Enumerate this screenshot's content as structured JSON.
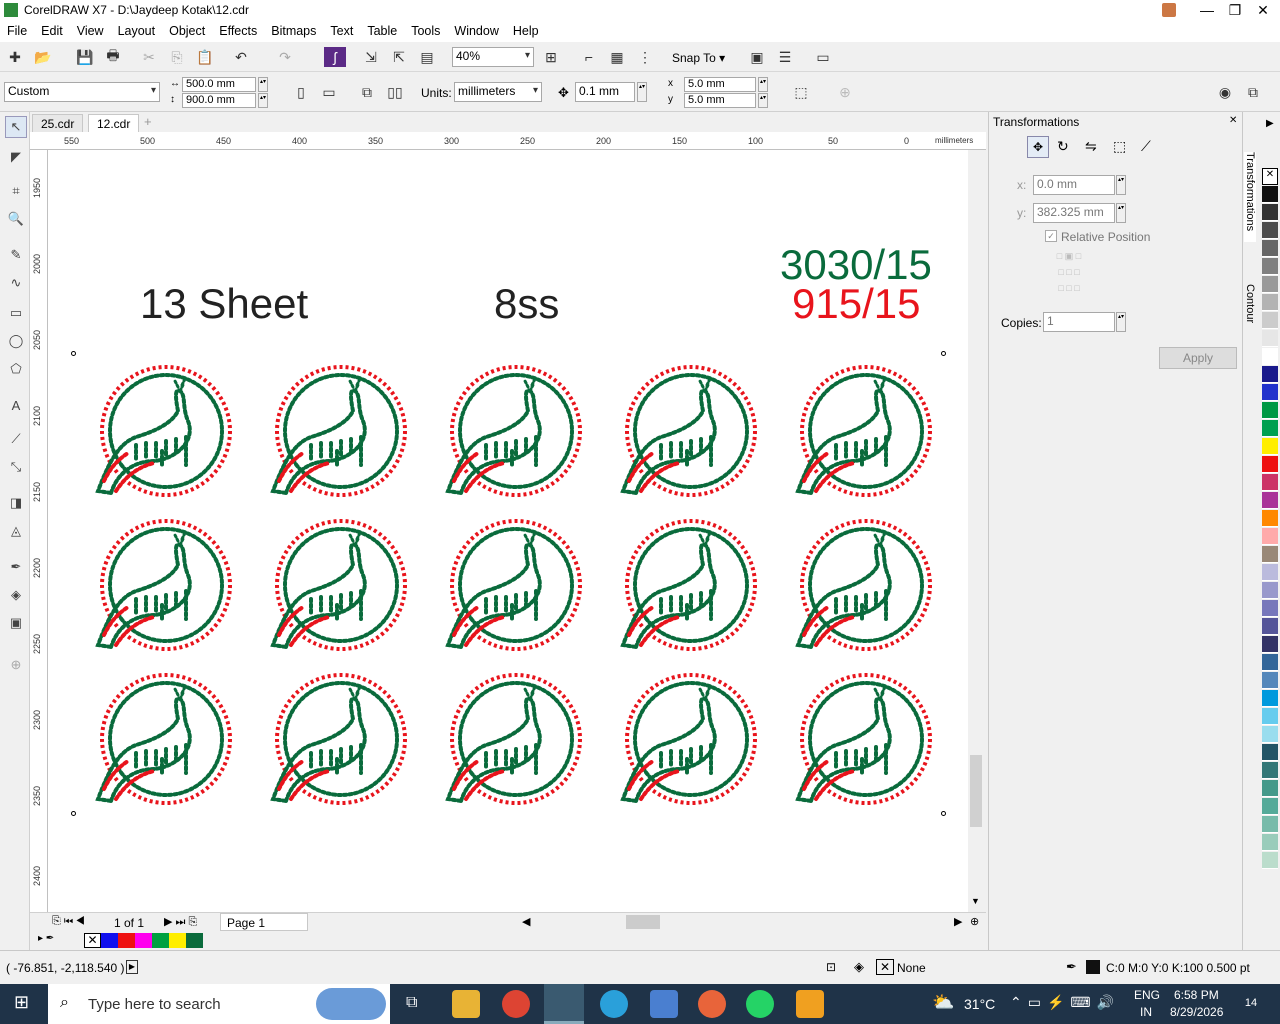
{
  "window": {
    "title": "CorelDRAW X7 - D:\\Jaydeep Kotak\\12.cdr",
    "min": "—",
    "max": "❐",
    "close": "✕"
  },
  "menu": [
    "File",
    "Edit",
    "View",
    "Layout",
    "Object",
    "Effects",
    "Bitmaps",
    "Text",
    "Table",
    "Tools",
    "Window",
    "Help"
  ],
  "toolbar": {
    "zoom": "40%",
    "snap_to": "Snap To"
  },
  "propbar": {
    "preset": "Custom",
    "width": "500.0 mm",
    "height": "900.0 mm",
    "units_label": "Units:",
    "units": "millimeters",
    "nudge": "0.1 mm",
    "dup_x": "5.0 mm",
    "dup_y": "5.0 mm"
  },
  "tabs": [
    {
      "label": "25.cdr"
    },
    {
      "label": "12.cdr"
    }
  ],
  "ruler": {
    "h_ticks": [
      "550",
      "500",
      "450",
      "400",
      "350",
      "300",
      "250",
      "200",
      "150",
      "100",
      "50",
      "0"
    ],
    "h_unit": "millimeters",
    "v_ticks": [
      "1950",
      "2000",
      "2050",
      "2100",
      "2150",
      "2200",
      "2250",
      "2300",
      "2350",
      "2400"
    ],
    "v_unit": "millimeters"
  },
  "canvas": {
    "text_sheet": "13 Sheet",
    "text_ss": "8ss",
    "text_green": "3030/15",
    "text_red": "915/15",
    "design_name": "peacock-rhinestone-motif",
    "rows": 3,
    "cols": 5,
    "colors": {
      "green": "#0a6b3c",
      "red": "#e8141c",
      "text": "#222222"
    }
  },
  "pagebar": {
    "page_count": "1 of 1",
    "page_tab": "Page 1"
  },
  "docker": {
    "title": "Transformations",
    "x_label": "x:",
    "x_value": "0.0 mm",
    "y_label": "y:",
    "y_value": "382.325 mm",
    "relative_position": "Relative Position",
    "copies_label": "Copies:",
    "copies_value": "1",
    "apply": "Apply",
    "side_tab_1": "Transformations",
    "side_tab_2": "Contour"
  },
  "status": {
    "coords": "( -76.851, -2,118.540 )",
    "fill": "None",
    "outline": "C:0 M:0 Y:0 K:100  0.500 pt"
  },
  "taskbar": {
    "search_placeholder": "Type here to search",
    "temp": "31°C",
    "lang1": "ENG",
    "lang2": "IN",
    "time": "6:58 PM",
    "date": "8/29/2026",
    "notif": "14"
  },
  "palette_colors": [
    "#111111",
    "#333333",
    "#4d4d4d",
    "#666666",
    "#808080",
    "#999999",
    "#b3b3b3",
    "#cccccc",
    "#e6e6e6",
    "#ffffff",
    "#1a1a8c",
    "#2233cc",
    "#009944",
    "#00a050",
    "#ffee00",
    "#ee1111",
    "#cc3366",
    "#aa3399",
    "#ff8800",
    "#ffaaaa",
    "#998877",
    "#bbbbdd",
    "#9999cc",
    "#7777bb",
    "#555599",
    "#333366",
    "#336699",
    "#5588bb",
    "#0099dd",
    "#66ccee",
    "#99ddee",
    "#225566",
    "#337777",
    "#44998a",
    "#55aa99",
    "#77bbaa",
    "#99ccbb",
    "#bbddcc"
  ]
}
